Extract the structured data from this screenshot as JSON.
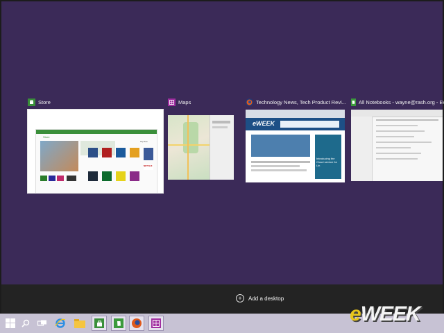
{
  "windows": [
    {
      "title": "Store",
      "icon": "store-icon",
      "color": "#3a8f3a"
    },
    {
      "title": "Maps",
      "icon": "maps-icon",
      "color": "#a12fa1"
    },
    {
      "title": "Technology News, Tech Product Revi...",
      "icon": "firefox-icon",
      "color": "#e05a1c"
    },
    {
      "title": "All Notebooks - wayne@rash.org - Ever",
      "icon": "evernote-icon",
      "color": "#3c9a3c"
    }
  ],
  "store": {
    "header": "Store",
    "netflix": "NETFLIX",
    "top_free": "Top free"
  },
  "browser": {
    "site": "eWEEK",
    "subtitle": "Introducing the Cloud service for Lin"
  },
  "add_desktop_label": "Add a desktop",
  "watermark": {
    "e": "e",
    "rest": "WEEK"
  },
  "colors": {
    "background": "#3b2a58",
    "taskbar": "#c7c2d4",
    "accent_store": "#3a8f3a",
    "accent_maps": "#a12fa1"
  }
}
